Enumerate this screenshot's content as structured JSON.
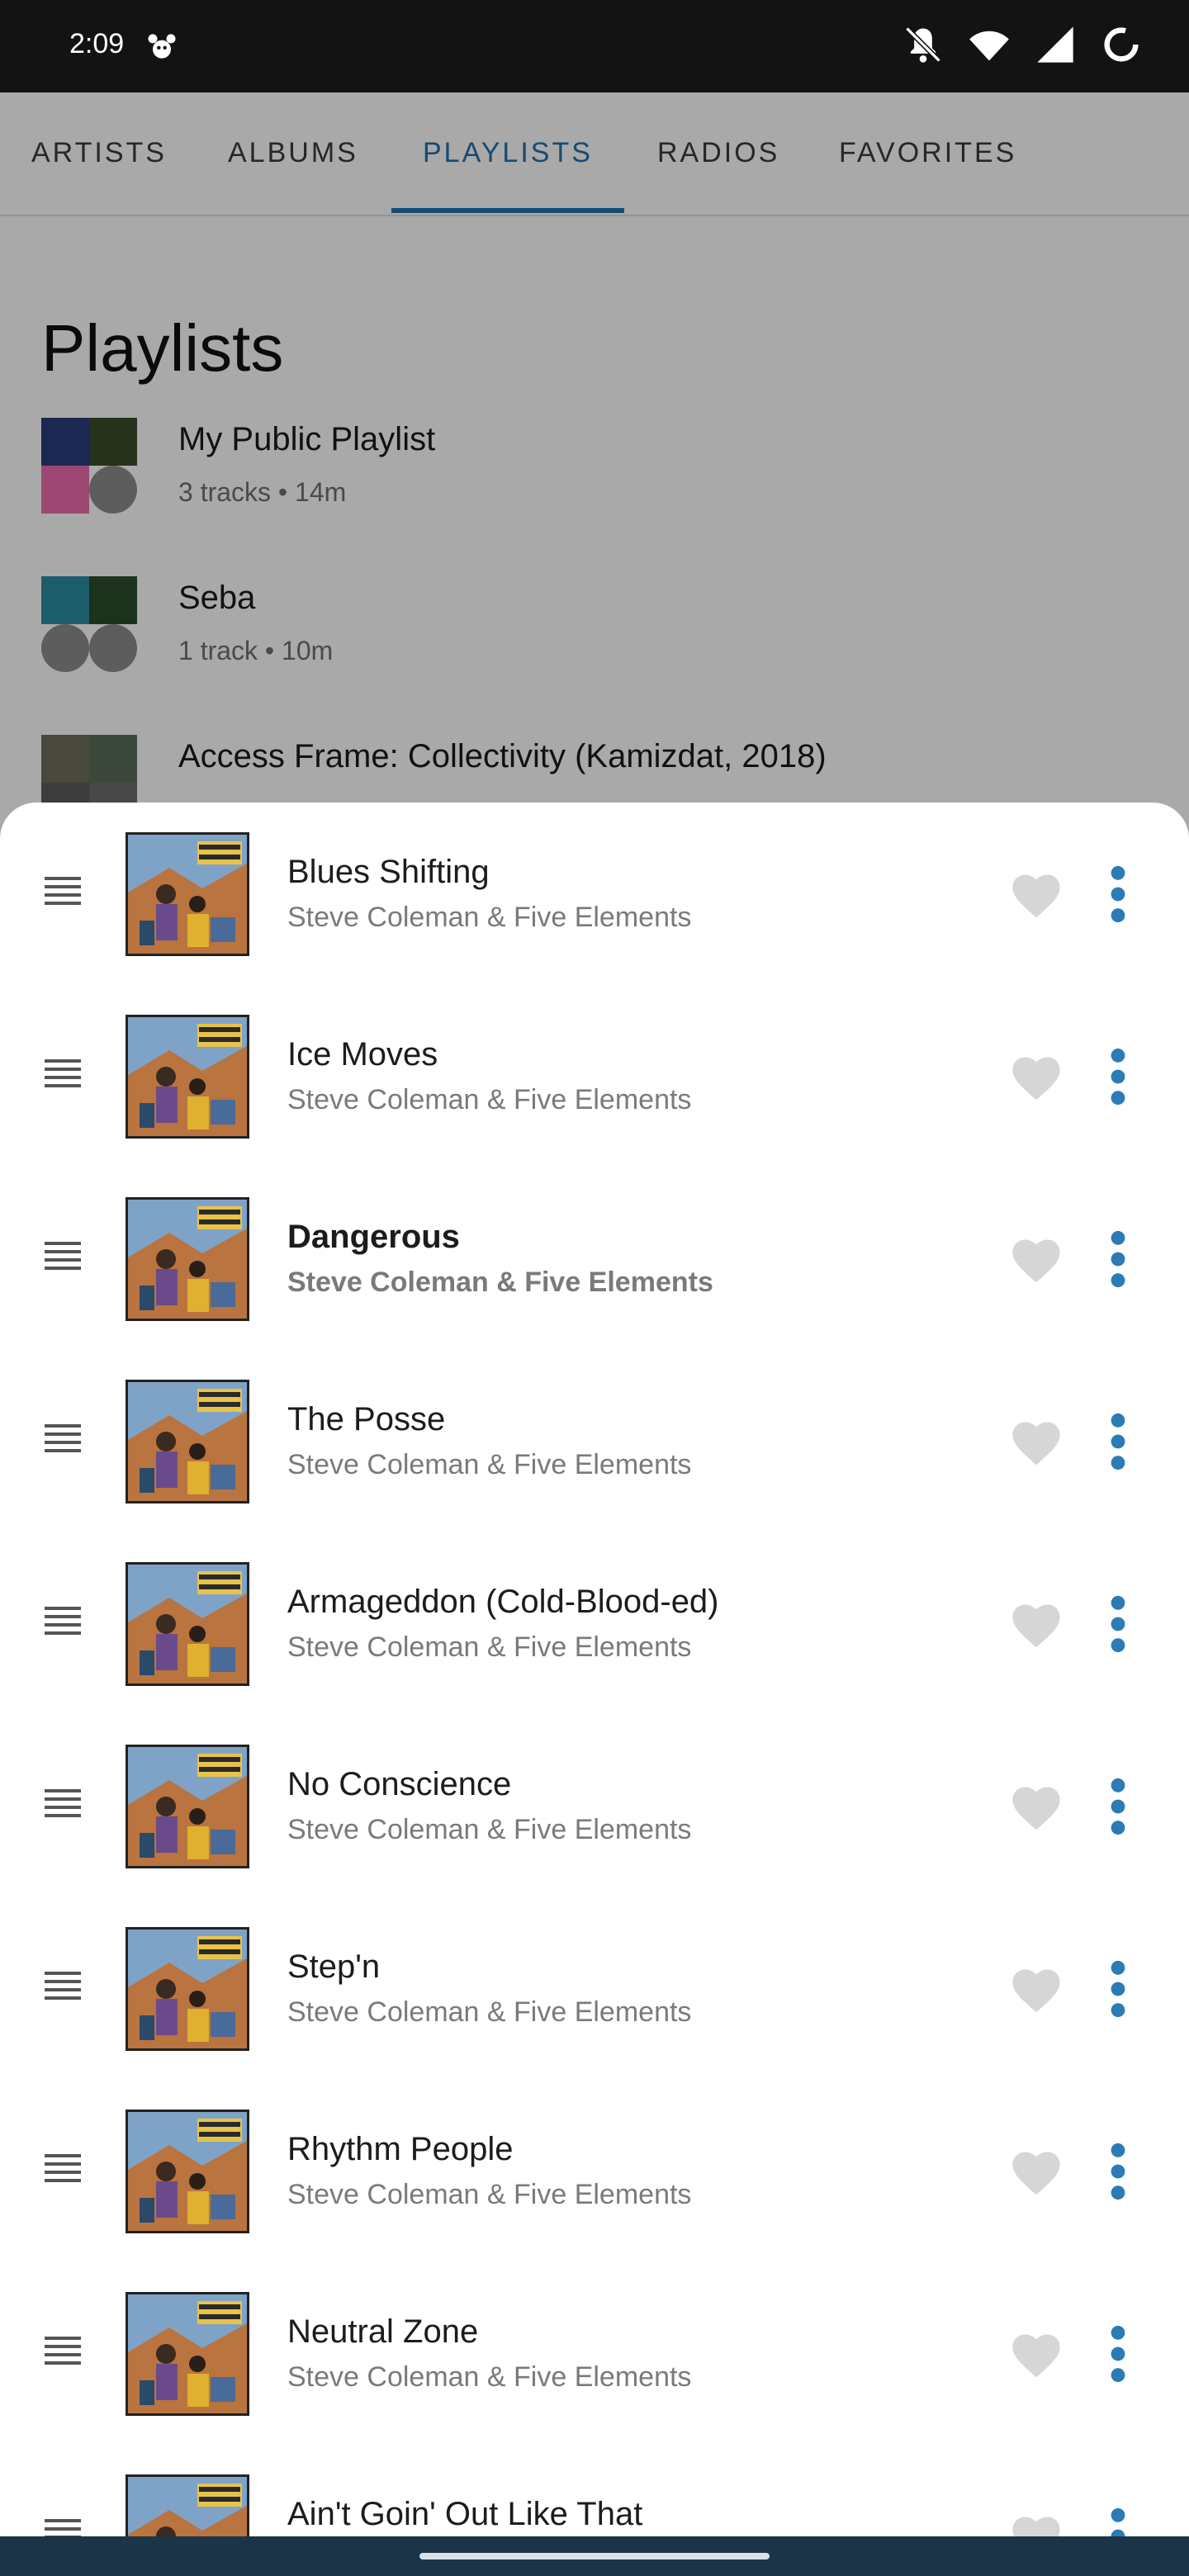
{
  "status_bar": {
    "time": "2:09",
    "icons": [
      "paw-icon",
      "bell-off-icon",
      "wifi-icon",
      "signal-icon",
      "loading-ring-icon"
    ]
  },
  "tabs": [
    {
      "label": "ARTISTS",
      "active": false
    },
    {
      "label": "ALBUMS",
      "active": false
    },
    {
      "label": "PLAYLISTS",
      "active": true
    },
    {
      "label": "RADIOS",
      "active": false
    },
    {
      "label": "FAVORITES",
      "active": false
    }
  ],
  "page": {
    "title": "Playlists",
    "playlists": [
      {
        "name": "My Public Playlist",
        "meta": "3 tracks • 14m"
      },
      {
        "name": "Seba",
        "meta": "1 track • 10m"
      },
      {
        "name": "Access Frame: Collectivity (Kamizdat, 2018)",
        "meta": ""
      }
    ]
  },
  "queue": {
    "tracks": [
      {
        "title": "Blues Shifting",
        "artist": "Steve Coleman & Five Elements",
        "current": false
      },
      {
        "title": "Ice Moves",
        "artist": "Steve Coleman & Five Elements",
        "current": false
      },
      {
        "title": "Dangerous",
        "artist": "Steve Coleman & Five Elements",
        "current": true
      },
      {
        "title": "The Posse",
        "artist": "Steve Coleman & Five Elements",
        "current": false
      },
      {
        "title": "Armageddon (Cold-Blood-ed)",
        "artist": "Steve Coleman & Five Elements",
        "current": false
      },
      {
        "title": "No Conscience",
        "artist": "Steve Coleman & Five Elements",
        "current": false
      },
      {
        "title": "Step'n",
        "artist": "Steve Coleman & Five Elements",
        "current": false
      },
      {
        "title": "Rhythm People",
        "artist": "Steve Coleman & Five Elements",
        "current": false
      },
      {
        "title": "Neutral Zone",
        "artist": "Steve Coleman & Five Elements",
        "current": false
      },
      {
        "title": "Ain't Goin' Out Like That",
        "artist": "Steve Coleman & Five Elements",
        "current": false
      }
    ],
    "album_cover_text": "STEVE COLEMAN RHYTHM PEOPLE"
  },
  "colors": {
    "accent": "#1f6fa8",
    "more_dots": "#2c7bb6",
    "heart": "#d6d6d6",
    "nav_bar": "#1c3447"
  }
}
